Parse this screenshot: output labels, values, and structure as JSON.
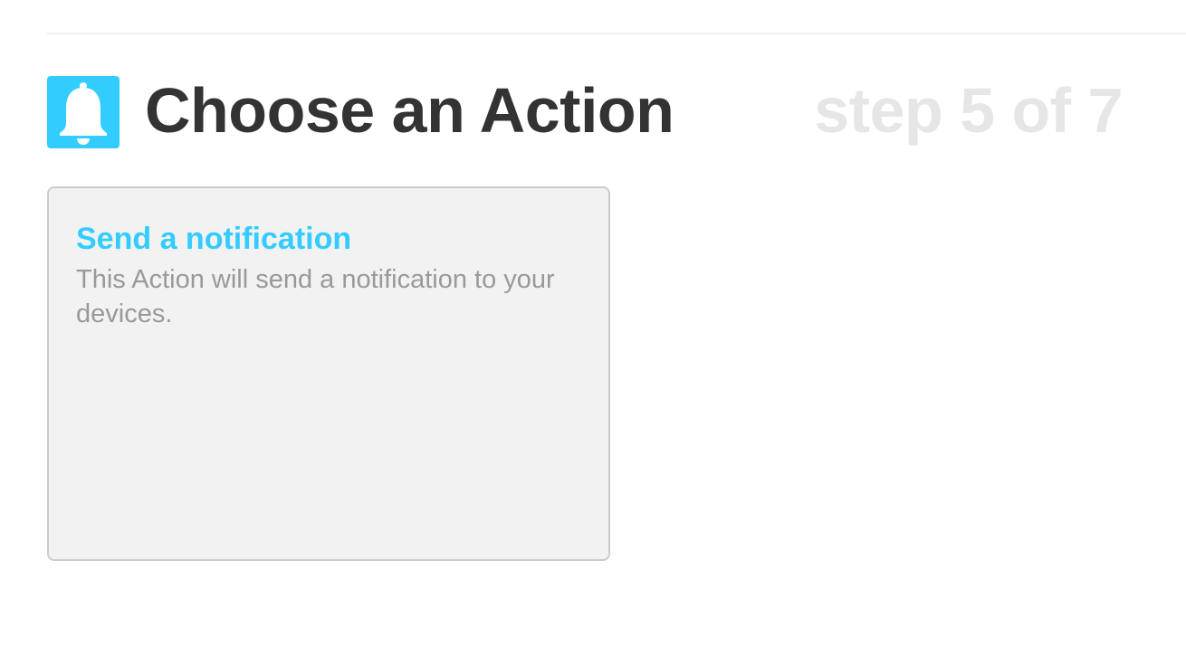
{
  "header": {
    "title": "Choose an Action",
    "step_label": "step 5 of 7",
    "channel_icon": "bell-icon",
    "channel_color": "#33ccff"
  },
  "actions": [
    {
      "title": "Send a notification",
      "description": "This Action will send a notification to your devices."
    }
  ],
  "colors": {
    "accent": "#33ccff",
    "title_text": "#333333",
    "step_text": "#e6e6e6",
    "card_background": "#f2f2f2",
    "card_border": "#cccccc",
    "description_text": "#999999"
  }
}
